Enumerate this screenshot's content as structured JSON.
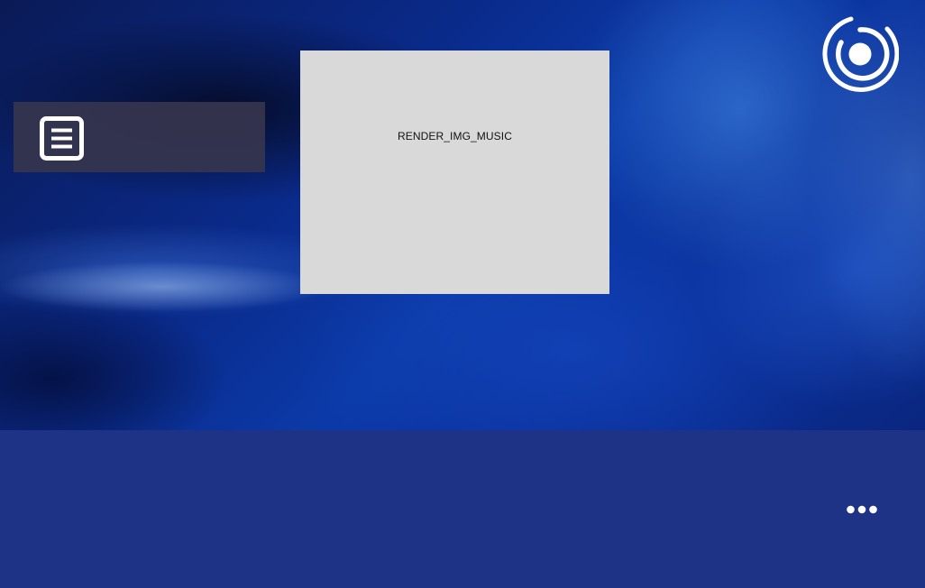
{
  "app": {
    "background_colors": {
      "wallpaper_base": "#0b3aa8",
      "wallpaper_dark": "#0a1a55",
      "bottom_bar": "#1f3386",
      "side_panel": "#34344e",
      "album_placeholder": "#d9d9d9"
    }
  },
  "side_panel": {
    "menu_icon": "list-menu-icon"
  },
  "album_art": {
    "placeholder_label": "RENDER_IMG_MUSIC"
  },
  "header": {
    "logo_icon": "app-logo-icon"
  },
  "bottom_bar": {
    "more_icon": "more-options-icon"
  }
}
